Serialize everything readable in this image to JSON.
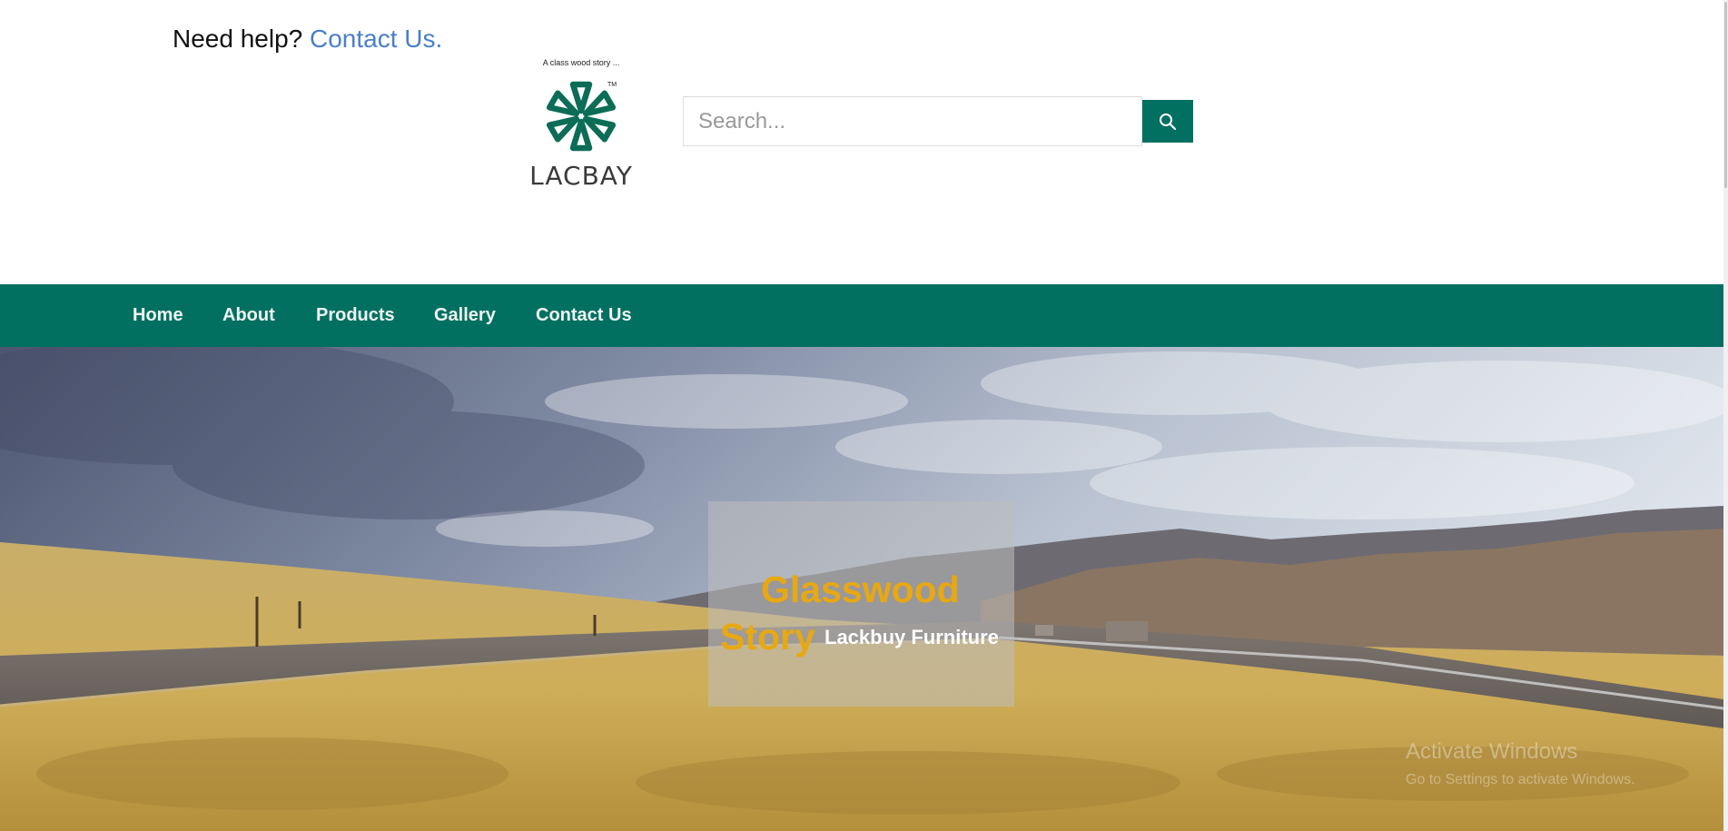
{
  "header": {
    "help_text": "Need help?",
    "contact_link": "Contact Us."
  },
  "logo": {
    "tagline": "A class wood story ...",
    "tm": "TM",
    "brand": "LACBAY"
  },
  "search": {
    "placeholder": "Search...",
    "value": "",
    "icon": "search-icon"
  },
  "nav": {
    "items": [
      {
        "label": "Home"
      },
      {
        "label": "About"
      },
      {
        "label": "Products"
      },
      {
        "label": "Gallery"
      },
      {
        "label": "Contact Us"
      }
    ]
  },
  "hero": {
    "title_line1": "Glasswood",
    "title_line2": "Story",
    "subtitle": "Lackbuy Furniture"
  },
  "watermark": {
    "line1": "Activate Windows",
    "line2": "Go to Settings to activate Windows."
  },
  "colors": {
    "brand_green": "#027060",
    "link_blue": "#4a7fc8",
    "hero_gold": "#e8a812"
  }
}
